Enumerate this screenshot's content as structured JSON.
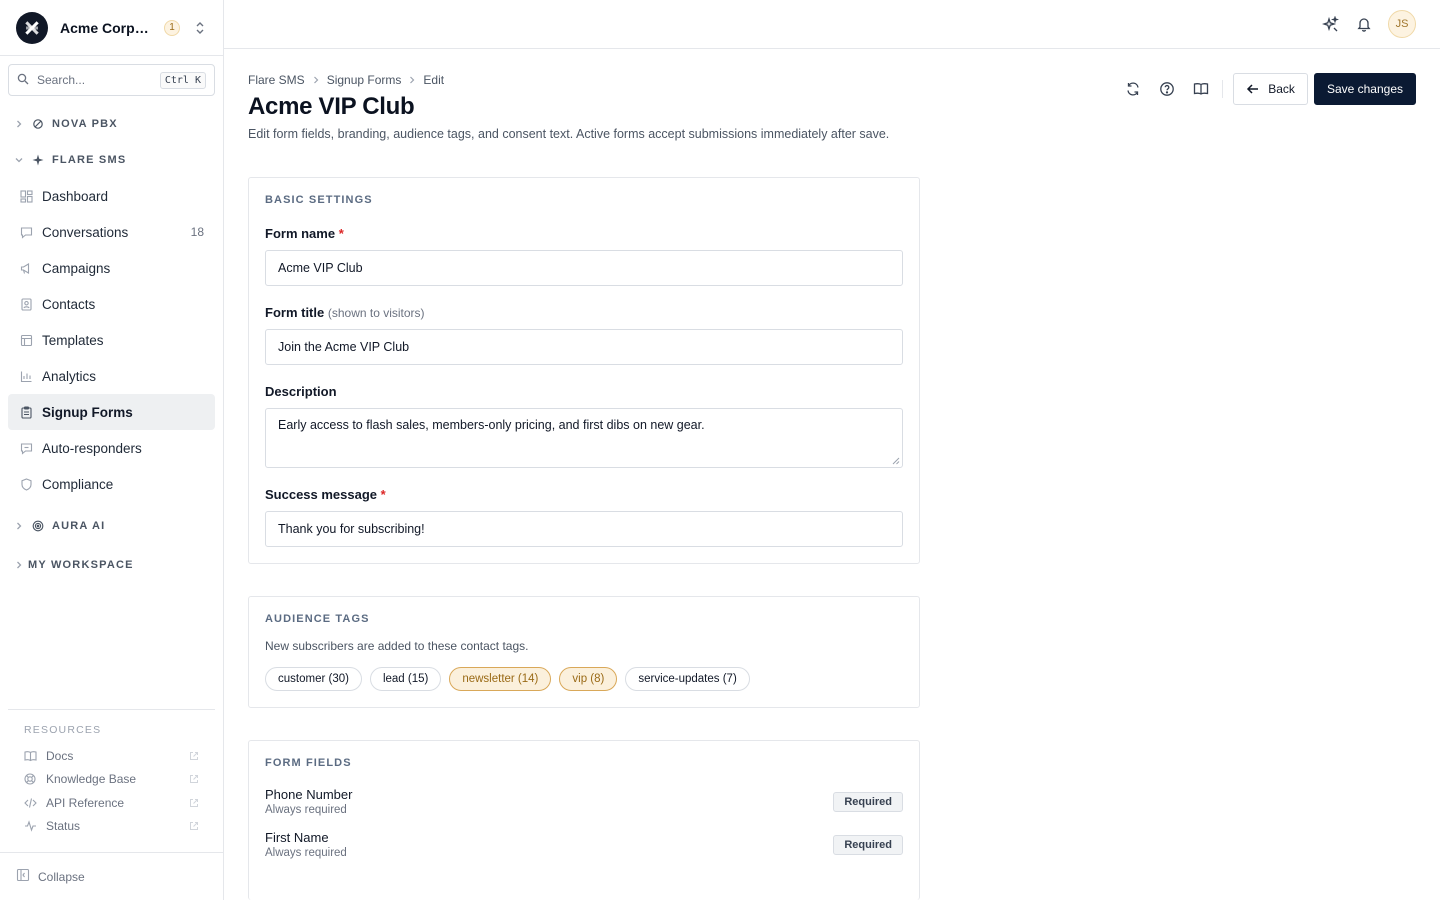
{
  "org": {
    "name": "Acme Corporation",
    "badge": "1"
  },
  "search": {
    "placeholder": "Search...",
    "shortcut": "Ctrl K"
  },
  "sidebar": {
    "sections": {
      "nova": "NOVA PBX",
      "flare": "FLARE SMS",
      "aura": "AURA AI",
      "workspace": "MY WORKSPACE"
    },
    "items": [
      {
        "label": "Dashboard",
        "icon": "dashboard-icon"
      },
      {
        "label": "Conversations",
        "icon": "chat-icon",
        "count": "18"
      },
      {
        "label": "Campaigns",
        "icon": "megaphone-icon"
      },
      {
        "label": "Contacts",
        "icon": "contacts-icon"
      },
      {
        "label": "Templates",
        "icon": "template-icon"
      },
      {
        "label": "Analytics",
        "icon": "analytics-icon"
      },
      {
        "label": "Signup Forms",
        "icon": "clipboard-icon",
        "active": true
      },
      {
        "label": "Auto-responders",
        "icon": "reply-icon"
      },
      {
        "label": "Compliance",
        "icon": "shield-icon"
      }
    ],
    "resources": {
      "heading": "RESOURCES",
      "items": [
        {
          "label": "Docs"
        },
        {
          "label": "Knowledge Base"
        },
        {
          "label": "API Reference"
        },
        {
          "label": "Status"
        }
      ]
    },
    "collapse_label": "Collapse"
  },
  "topbar": {
    "avatar_initials": "JS"
  },
  "breadcrumb": [
    "Flare SMS",
    "Signup Forms",
    "Edit"
  ],
  "page": {
    "title": "Acme VIP Club",
    "description": "Edit form fields, branding, audience tags, and consent text. Active forms accept submissions immediately after save."
  },
  "actions": {
    "back": "Back",
    "save": "Save changes"
  },
  "basic_settings": {
    "heading": "BASIC SETTINGS",
    "form_name_label": "Form name",
    "form_name_value": "Acme VIP Club",
    "form_title_label": "Form title",
    "form_title_hint": "(shown to visitors)",
    "form_title_value": "Join the Acme VIP Club",
    "description_label": "Description",
    "description_value": "Early access to flash sales, members-only pricing, and first dibs on new gear.",
    "success_label": "Success message",
    "success_value": "Thank you for subscribing!",
    "required_mark": "*"
  },
  "audience_tags": {
    "heading": "AUDIENCE TAGS",
    "note": "New subscribers are added to these contact tags.",
    "tags": [
      {
        "label": "customer (30)",
        "selected": false
      },
      {
        "label": "lead (15)",
        "selected": false
      },
      {
        "label": "newsletter (14)",
        "selected": true
      },
      {
        "label": "vip (8)",
        "selected": true
      },
      {
        "label": "service-updates (7)",
        "selected": false
      }
    ]
  },
  "form_fields": {
    "heading": "FORM FIELDS",
    "rows": [
      {
        "name": "Phone Number",
        "sub": "Always required",
        "badge": "Required"
      },
      {
        "name": "First Name",
        "sub": "Always required",
        "badge": "Required"
      }
    ]
  },
  "colors": {
    "accent": "#0b1a33",
    "tag_selected": "#fbf0dc",
    "required": "#dc2626"
  }
}
